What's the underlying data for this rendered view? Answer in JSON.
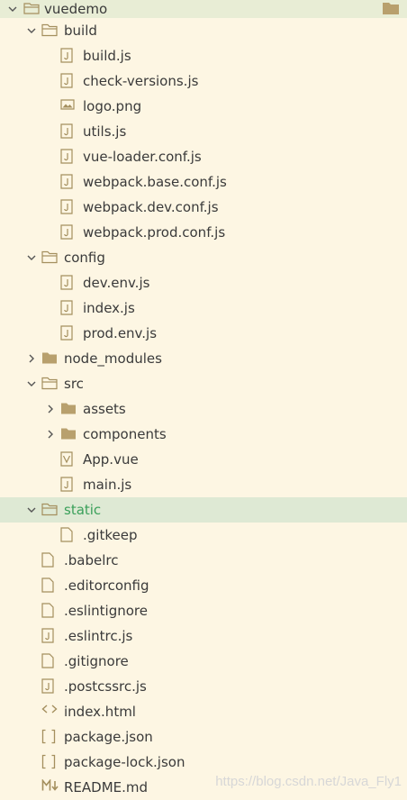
{
  "root": {
    "label": "vuedemo"
  },
  "items": [
    {
      "label": "build",
      "type": "folder",
      "level": 1,
      "expanded": true
    },
    {
      "label": "build.js",
      "type": "js",
      "level": 2
    },
    {
      "label": "check-versions.js",
      "type": "js",
      "level": 2
    },
    {
      "label": "logo.png",
      "type": "image",
      "level": 2
    },
    {
      "label": "utils.js",
      "type": "js",
      "level": 2
    },
    {
      "label": "vue-loader.conf.js",
      "type": "js",
      "level": 2
    },
    {
      "label": "webpack.base.conf.js",
      "type": "js",
      "level": 2
    },
    {
      "label": "webpack.dev.conf.js",
      "type": "js",
      "level": 2
    },
    {
      "label": "webpack.prod.conf.js",
      "type": "js",
      "level": 2
    },
    {
      "label": "config",
      "type": "folder",
      "level": 1,
      "expanded": true
    },
    {
      "label": "dev.env.js",
      "type": "js",
      "level": 2
    },
    {
      "label": "index.js",
      "type": "js",
      "level": 2
    },
    {
      "label": "prod.env.js",
      "type": "js",
      "level": 2
    },
    {
      "label": "node_modules",
      "type": "folder",
      "level": 1,
      "expanded": false
    },
    {
      "label": "src",
      "type": "folder",
      "level": 1,
      "expanded": true
    },
    {
      "label": "assets",
      "type": "folder",
      "level": 2,
      "expanded": false
    },
    {
      "label": "components",
      "type": "folder",
      "level": 2,
      "expanded": false
    },
    {
      "label": "App.vue",
      "type": "vue",
      "level": 2
    },
    {
      "label": "main.js",
      "type": "js",
      "level": 2
    },
    {
      "label": "static",
      "type": "folder",
      "level": 1,
      "expanded": true,
      "selected": true
    },
    {
      "label": ".gitkeep",
      "type": "file",
      "level": 2
    },
    {
      "label": ".babelrc",
      "type": "file",
      "level": 1
    },
    {
      "label": ".editorconfig",
      "type": "file",
      "level": 1
    },
    {
      "label": ".eslintignore",
      "type": "file",
      "level": 1
    },
    {
      "label": ".eslintrc.js",
      "type": "js",
      "level": 1
    },
    {
      "label": ".gitignore",
      "type": "file",
      "level": 1
    },
    {
      "label": ".postcssrc.js",
      "type": "js",
      "level": 1
    },
    {
      "label": "index.html",
      "type": "html",
      "level": 1
    },
    {
      "label": "package.json",
      "type": "json",
      "level": 1
    },
    {
      "label": "package-lock.json",
      "type": "json",
      "level": 1
    },
    {
      "label": "README.md",
      "type": "md",
      "level": 1
    }
  ],
  "icons": {
    "folder": "folder-icon",
    "folder-open": "folder-open-icon",
    "js": "js-file-icon",
    "image": "image-file-icon",
    "vue": "vue-file-icon",
    "file": "file-icon",
    "html": "html-file-icon",
    "json": "json-file-icon",
    "md": "markdown-file-icon"
  },
  "colors": {
    "background": "#fdf6e3",
    "root_row": "#e8edd5",
    "selected_row": "#dee9d4",
    "selected_text": "#3aa05a",
    "folder": "#b8a06d",
    "icon_stroke": "#a48f5e"
  },
  "watermark": "https://blog.csdn.net/Java_Fly1"
}
